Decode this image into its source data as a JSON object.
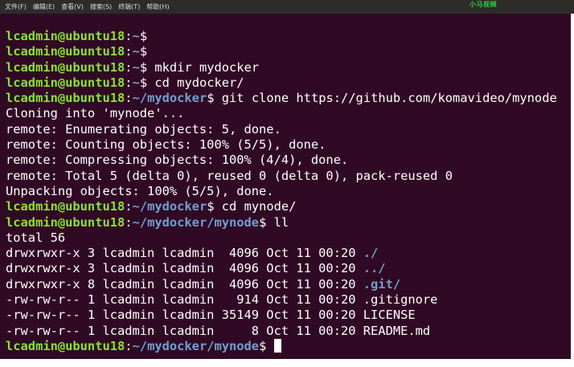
{
  "menubar": {
    "items": [
      "文件(F)",
      "编辑(E)",
      "查看(V)",
      "搜索(S)",
      "终端(T)",
      "帮助(H)"
    ]
  },
  "watermark": "小马视频",
  "terminal": {
    "colors": {
      "background": "#300a24",
      "user_host": "#8ae234",
      "path": "#729fcf",
      "text": "#ffffff"
    },
    "prompt_user": "lcadmin@ubuntu18",
    "lines": [
      {
        "kind": "prompt",
        "path": "~",
        "command": ""
      },
      {
        "kind": "prompt",
        "path": "~",
        "command": ""
      },
      {
        "kind": "prompt",
        "path": "~",
        "command": "mkdir mydocker"
      },
      {
        "kind": "prompt",
        "path": "~",
        "command": "cd mydocker/"
      },
      {
        "kind": "prompt",
        "path": "~/mydocker",
        "command": "git clone https://github.com/komavideo/mynode"
      },
      {
        "kind": "output",
        "text": "Cloning into 'mynode'..."
      },
      {
        "kind": "output",
        "text": "remote: Enumerating objects: 5, done."
      },
      {
        "kind": "output",
        "text": "remote: Counting objects: 100% (5/5), done."
      },
      {
        "kind": "output",
        "text": "remote: Compressing objects: 100% (4/4), done."
      },
      {
        "kind": "output",
        "text": "remote: Total 5 (delta 0), reused 0 (delta 0), pack-reused 0"
      },
      {
        "kind": "output",
        "text": "Unpacking objects: 100% (5/5), done."
      },
      {
        "kind": "prompt",
        "path": "~/mydocker",
        "command": "cd mynode/"
      },
      {
        "kind": "prompt",
        "path": "~/mydocker/mynode",
        "command": "ll"
      },
      {
        "kind": "output",
        "text": "total 56"
      },
      {
        "kind": "listing",
        "prefix": "drwxrwxr-x 3 lcadmin lcadmin  4096 Oct 11 00:20 ",
        "name": "./",
        "is_dir": true
      },
      {
        "kind": "listing",
        "prefix": "drwxrwxr-x 3 lcadmin lcadmin  4096 Oct 11 00:20 ",
        "name": "../",
        "is_dir": true
      },
      {
        "kind": "listing",
        "prefix": "drwxrwxr-x 8 lcadmin lcadmin  4096 Oct 11 00:20 ",
        "name": ".git/",
        "is_dir": true
      },
      {
        "kind": "listing",
        "prefix": "-rw-rw-r-- 1 lcadmin lcadmin   914 Oct 11 00:20 ",
        "name": ".gitignore",
        "is_dir": false
      },
      {
        "kind": "listing",
        "prefix": "-rw-rw-r-- 1 lcadmin lcadmin 35149 Oct 11 00:20 ",
        "name": "LICENSE",
        "is_dir": false
      },
      {
        "kind": "listing",
        "prefix": "-rw-rw-r-- 1 lcadmin lcadmin     8 Oct 11 00:20 ",
        "name": "README.md",
        "is_dir": false
      },
      {
        "kind": "prompt",
        "path": "~/mydocker/mynode",
        "command": "",
        "cursor": true
      }
    ]
  }
}
